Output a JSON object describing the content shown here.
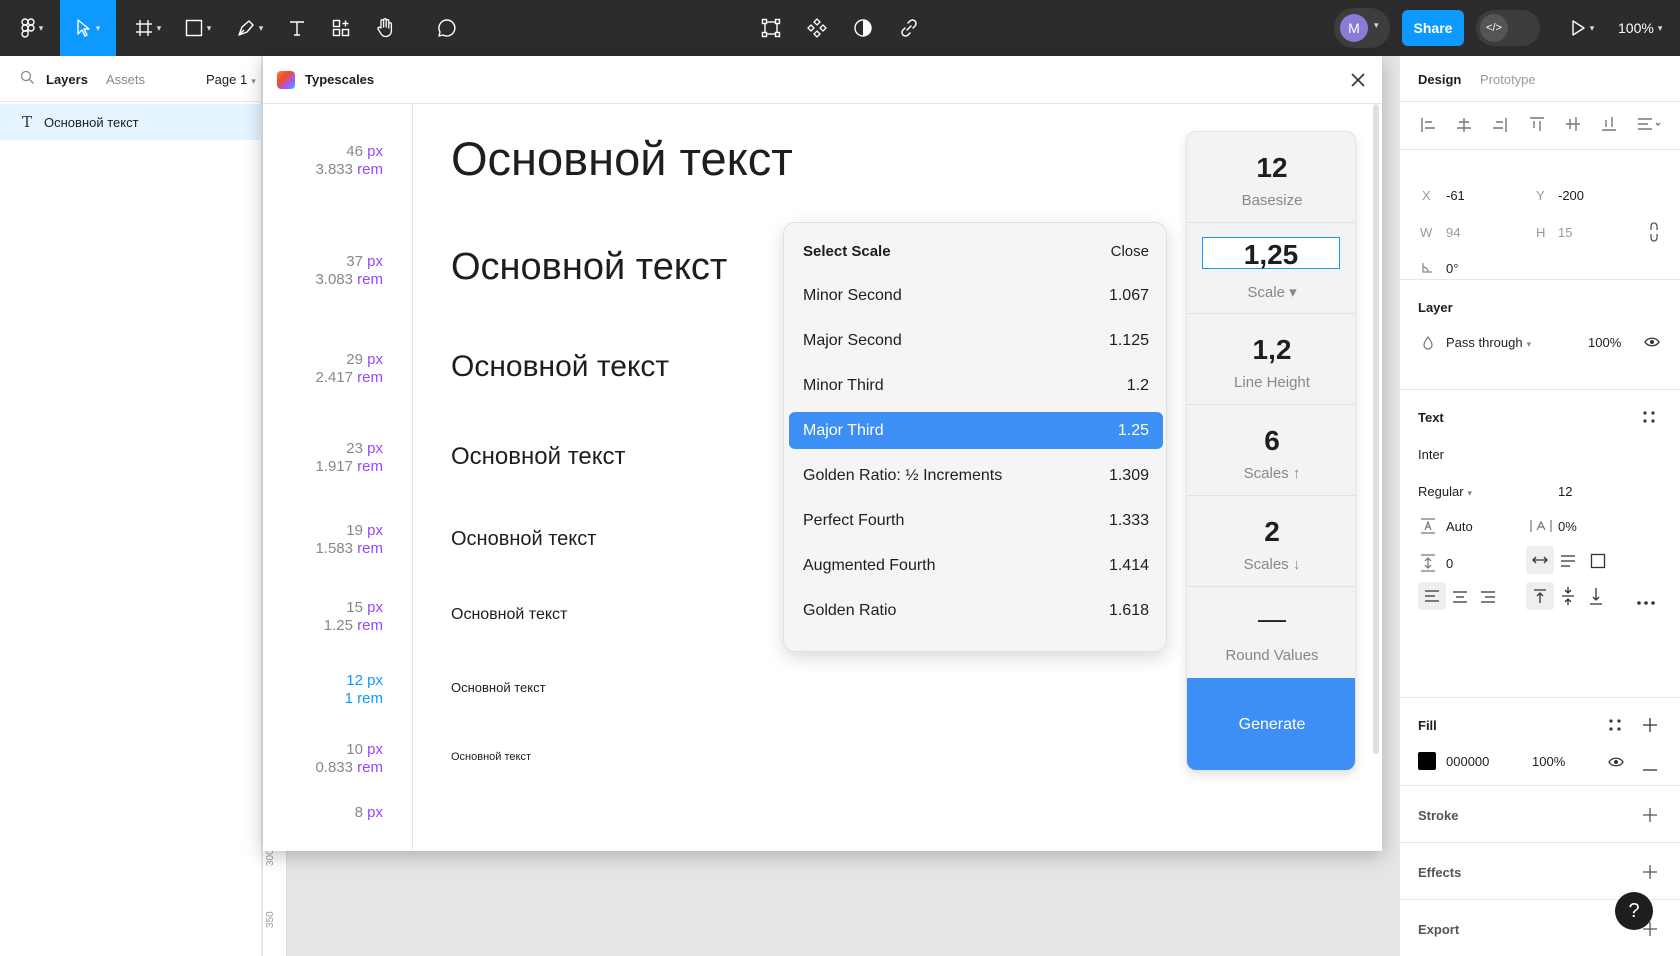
{
  "toolbar": {
    "avatar_initial": "M",
    "share_label": "Share",
    "devmode_label": "</>",
    "zoom_label": "100%"
  },
  "left_panel": {
    "tabs": {
      "layers": "Layers",
      "assets": "Assets"
    },
    "page_label": "Page 1",
    "layer_icon": "T",
    "layer_name": "Основной текст"
  },
  "ruler": {
    "labels": [
      "300",
      "350"
    ]
  },
  "plugin": {
    "title": "Typescales",
    "sample_text": "Основной текст",
    "sizes": [
      {
        "px": "46",
        "rem": "3.833",
        "base": false
      },
      {
        "px": "37",
        "rem": "3.083",
        "base": false
      },
      {
        "px": "29",
        "rem": "2.417",
        "base": false
      },
      {
        "px": "23",
        "rem": "1.917",
        "base": false
      },
      {
        "px": "19",
        "rem": "1.583",
        "base": false
      },
      {
        "px": "15",
        "rem": "1.25",
        "base": false
      },
      {
        "px": "12",
        "rem": "1",
        "base": true
      },
      {
        "px": "10",
        "rem": "0.833",
        "base": false
      },
      {
        "px": "8",
        "rem": "",
        "base": false
      }
    ],
    "px_unit": "px",
    "rem_unit": "rem",
    "controls": {
      "basesize_value": "12",
      "basesize_label": "Basesize",
      "scale_value": "1,25",
      "scale_label": "Scale ▾",
      "line_height_value": "1,2",
      "line_height_label": "Line Height",
      "scales_up_value": "6",
      "scales_up_label": "Scales ↑",
      "scales_down_value": "2",
      "scales_down_label": "Scales ↓",
      "round_value": "—",
      "round_label": "Round Values",
      "generate_label": "Generate"
    },
    "dropdown": {
      "title": "Select Scale",
      "close_label": "Close",
      "items": [
        {
          "name": "Minor Second",
          "value": "1.067",
          "selected": false
        },
        {
          "name": "Major Second",
          "value": "1.125",
          "selected": false
        },
        {
          "name": "Minor Third",
          "value": "1.2",
          "selected": false
        },
        {
          "name": "Major Third",
          "value": "1.25",
          "selected": true
        },
        {
          "name": "Golden Ratio: ½ Increments",
          "value": "1.309",
          "selected": false
        },
        {
          "name": "Perfect Fourth",
          "value": "1.333",
          "selected": false
        },
        {
          "name": "Augmented Fourth",
          "value": "1.414",
          "selected": false
        },
        {
          "name": "Golden Ratio",
          "value": "1.618",
          "selected": false
        }
      ]
    }
  },
  "right_panel": {
    "tabs": {
      "design": "Design",
      "prototype": "Prototype"
    },
    "position": {
      "x_label": "X",
      "x_value": "-61",
      "y_label": "Y",
      "y_value": "-200",
      "w_label": "W",
      "w_value": "94",
      "h_label": "H",
      "h_value": "15",
      "rotation": "0°"
    },
    "layer": {
      "title": "Layer",
      "blend": "Pass through",
      "opacity": "100%"
    },
    "text": {
      "title": "Text",
      "font": "Inter",
      "weight": "Regular",
      "size": "12",
      "line_height": "Auto",
      "letter_spacing": "0%",
      "paragraph_spacing": "0"
    },
    "fill": {
      "title": "Fill",
      "hex": "000000",
      "opacity": "100%",
      "color": "#000000"
    },
    "stroke_title": "Stroke",
    "effects_title": "Effects",
    "export_title": "Export",
    "help_label": "?"
  },
  "colors": {
    "accent": "#0d99ff",
    "selection": "#3d8ff5",
    "rem_purple": "#9747ff",
    "toolbar_bg": "#2c2c2c"
  }
}
